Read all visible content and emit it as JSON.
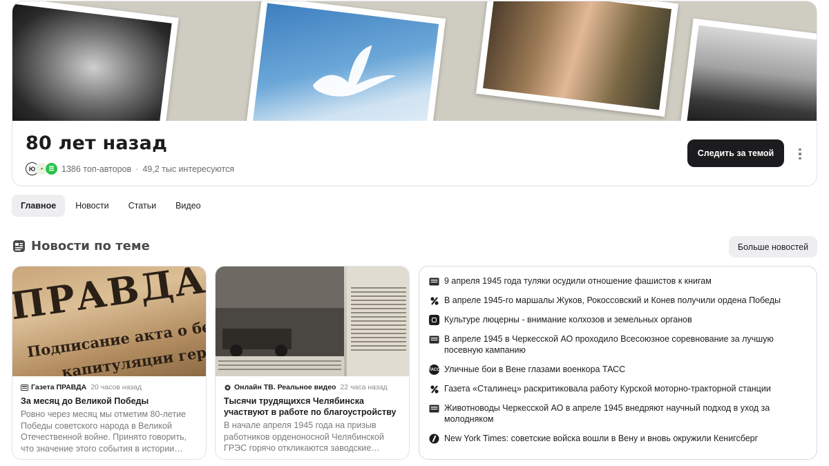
{
  "topic": {
    "title": "80 лет назад",
    "authors": "1386 топ-авторов",
    "separator": "·",
    "interested": "49,2 тыс интересуются",
    "follow_label": "Следить за темой",
    "avatars": [
      "author-avatar-1",
      "author-avatar-2",
      "author-avatar-3"
    ]
  },
  "tabs": [
    {
      "label": "Главное",
      "active": true
    },
    {
      "label": "Новости",
      "active": false
    },
    {
      "label": "Статьи",
      "active": false
    },
    {
      "label": "Видео",
      "active": false
    }
  ],
  "section": {
    "title": "Новости по теме",
    "more_label": "Больше новостей"
  },
  "cards": [
    {
      "source": "Газета ПРАВДА",
      "time": "20 часов назад",
      "title": "За месяц до Великой Победы",
      "snippet": "Ровно через месяц мы отметим 80-летие Победы советского народа в Великой Отечественной войне. Принято говорить, что значение этого события в истории…"
    },
    {
      "source": "Онлайн ТВ. Реальное видео",
      "time": "22 часа назад",
      "title": "Тысячи трудящихся Челябинска участвуют в работе по благоустройству",
      "snippet": "В начале апреля 1945 года на призыв работников орденоносной Челябинской ГРЭС горячо откликаются заводские…"
    }
  ],
  "news_list": [
    {
      "icon": "newspaper-icon",
      "text": "9 апреля 1945 года туляки осудили отношение фашистов к книгам"
    },
    {
      "icon": "percent-logo-icon",
      "text": "В апреле 1945-го маршалы Жуков, Рокоссовский и Конев получили ордена Победы"
    },
    {
      "icon": "square-logo-icon",
      "text": "Культуре люцерны - внимание колхозов и земельных органов"
    },
    {
      "icon": "newspaper-icon",
      "text": "В апреле 1945 в Черкесской АО проходило Всесоюзное соревнование за лучшую посевную кампанию"
    },
    {
      "icon": "tass-icon",
      "text": "Уличные бои в Вене глазами военкора ТАСС"
    },
    {
      "icon": "percent-logo-icon",
      "text": "Газета «Сталинец» раскритиковала работу Курской моторно-тракторной станции"
    },
    {
      "icon": "newspaper-icon",
      "text": "Животноводы Черкесской АО в апреле 1945 внедряют научный подход в уход за молодняком"
    },
    {
      "icon": "slash-logo-icon",
      "text": "New York Times: советские войска вошли в Вену и вновь окружили Кенигсберг"
    }
  ]
}
